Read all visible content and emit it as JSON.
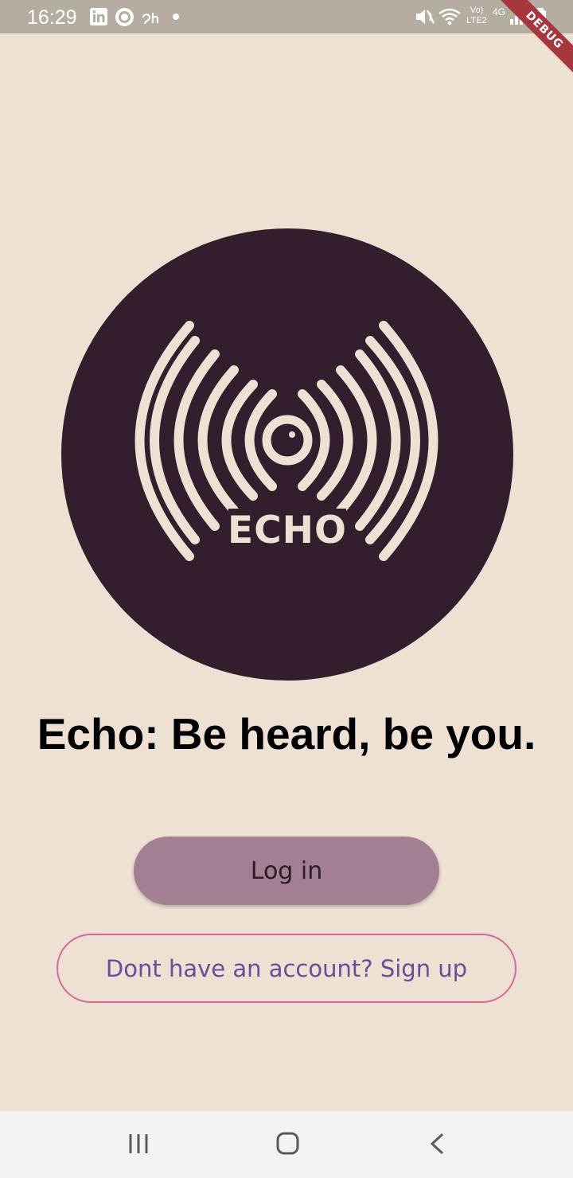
{
  "status_bar": {
    "time": "16:29",
    "left_icons": [
      "linkedin-icon",
      "record-icon",
      "app-icon",
      "dot-icon"
    ],
    "right_icons": [
      "mute-vibrate-icon",
      "wifi-icon",
      "volte-icon",
      "4g-icon",
      "signal-icon",
      "battery-icon"
    ],
    "volte_label": "Vo)",
    "lte_label": "LTE2",
    "network_label": "4G"
  },
  "debug_banner": "DEBUG",
  "logo": {
    "text": "ECHO",
    "circle_color": "#321E2C",
    "ink_color": "#EEE0D3"
  },
  "tagline": "Echo: Be heard, be you.",
  "actions": {
    "login_label": "Log in",
    "signup_label": "Dont have an account? Sign up"
  },
  "nav_bar": {
    "buttons": [
      "recent-apps-icon",
      "home-icon",
      "back-icon"
    ]
  },
  "colors": {
    "background": "#EEE0D3",
    "login_button": "#A37F93",
    "signup_border": "#D66A97",
    "signup_text": "#6B4C9A"
  }
}
